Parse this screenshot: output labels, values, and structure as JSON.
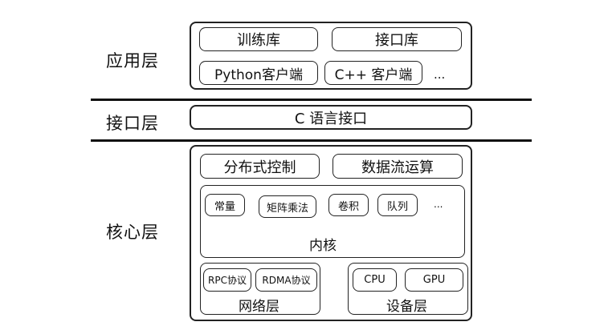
{
  "layers": {
    "app_label": "应用层",
    "iface_label": "接口层",
    "core_label": "核心层"
  },
  "app": {
    "training_lib": "训练库",
    "interface_lib": "接口库",
    "python_client": "Python客户端",
    "cpp_client": "C++ 客户端",
    "ellipsis": "..."
  },
  "iface": {
    "c_api": "C 语言接口"
  },
  "core": {
    "distributed_control": "分布式控制",
    "dataflow_compute": "数据流运算",
    "kernel": {
      "label": "内核",
      "items": [
        "常量",
        "矩阵乘法",
        "卷积",
        "队列"
      ],
      "ellipsis": "..."
    },
    "network": {
      "label": "网络层",
      "items": [
        "RPC协议",
        "RDMA协议"
      ]
    },
    "device": {
      "label": "设备层",
      "items": [
        "CPU",
        "GPU"
      ]
    }
  }
}
